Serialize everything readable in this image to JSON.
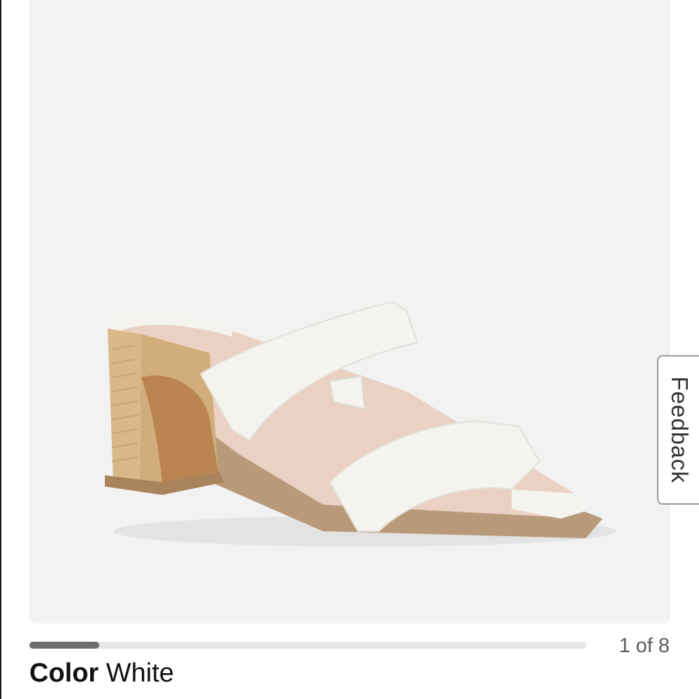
{
  "gallery": {
    "image_alt": "White double-strap block heel sandal",
    "counter": "1 of 8",
    "current_index": 1,
    "total_images": 8
  },
  "feedback": {
    "label": "Feedback"
  },
  "product": {
    "color_label": "Color",
    "color_value": "White"
  },
  "colors": {
    "image_background": "#f2f2f2",
    "progress_track": "#e6e6e6",
    "progress_fill": "#6e6e6e",
    "sandal_strap": "#f4f3ee",
    "sandal_insole": "#ead1c3",
    "heel_raffia": "#d9b88a",
    "heel_inner": "#b9844f"
  },
  "icons": {
    "product": "sandal-image"
  }
}
